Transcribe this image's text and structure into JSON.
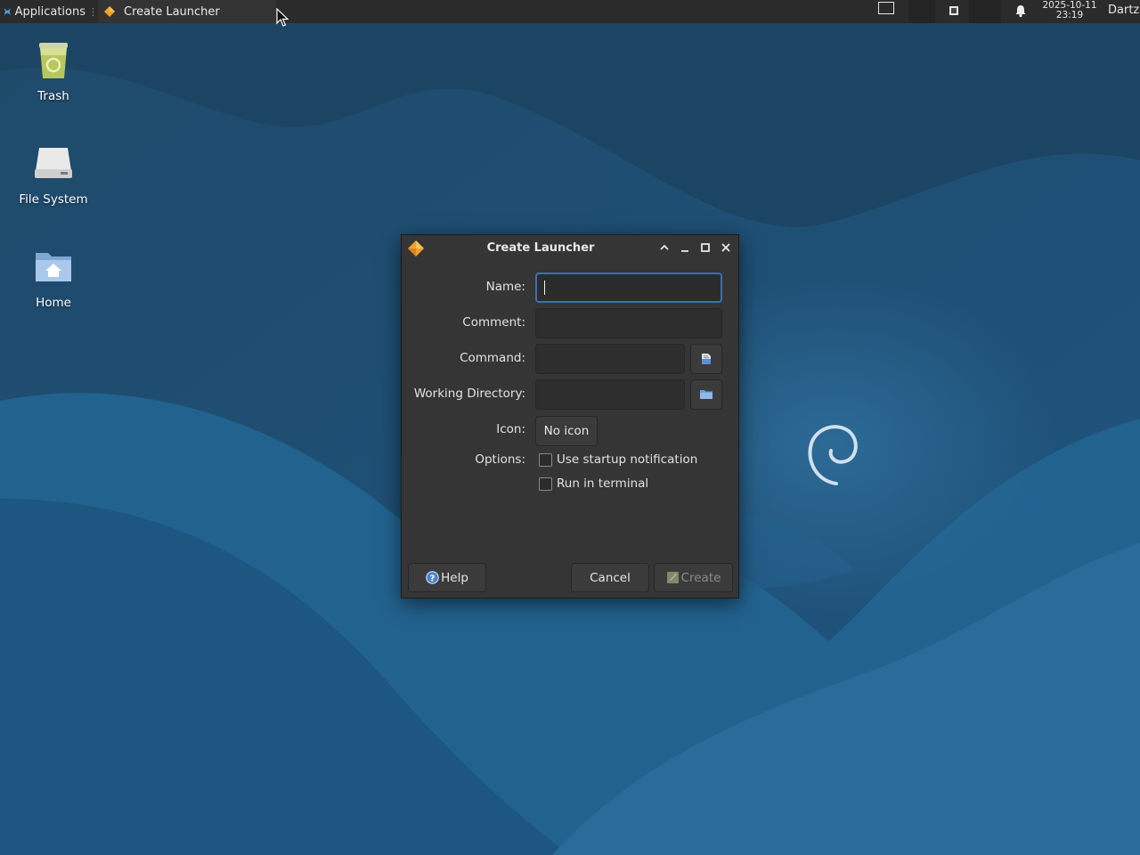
{
  "panel": {
    "applications_label": "Applications",
    "applications_icon": "xfce-mouse-icon",
    "separator": "⋮",
    "task_label": "Create Launcher",
    "task_icon": "launcher-diamond-icon",
    "workspace_icon": "workspace-icon",
    "tray_icon": "tray-square-icon",
    "notification_icon": "bell-icon",
    "clock_date": "2025-10-11",
    "clock_time": "23:19",
    "user": "Dartz"
  },
  "desktop": {
    "icons": [
      {
        "label": "Trash",
        "icon": "trash-icon"
      },
      {
        "label": "File System",
        "icon": "drive-icon"
      },
      {
        "label": "Home",
        "icon": "home-folder-icon"
      }
    ]
  },
  "dialog": {
    "title": "Create Launcher",
    "fields": {
      "name_label": "Name:",
      "name_value": "",
      "comment_label": "Comment:",
      "comment_value": "",
      "command_label": "Command:",
      "command_value": "",
      "workdir_label": "Working Directory:",
      "workdir_value": "",
      "icon_label": "Icon:",
      "icon_button": "No icon",
      "options_label": "Options:",
      "startup_notification": "Use startup notification",
      "run_in_terminal": "Run in terminal"
    },
    "options_state": {
      "startup_notification": false,
      "run_in_terminal": false
    },
    "buttons": {
      "help": "Help",
      "cancel": "Cancel",
      "create": "Create"
    }
  },
  "colors": {
    "wallpaper_dark": "#1e4a6b",
    "wallpaper_light": "#2a6a98",
    "panel_bg": "#2b2b2b",
    "dialog_bg": "#353535",
    "focus_border": "#3b6fb5",
    "accent_orange": "#f0a02c"
  }
}
